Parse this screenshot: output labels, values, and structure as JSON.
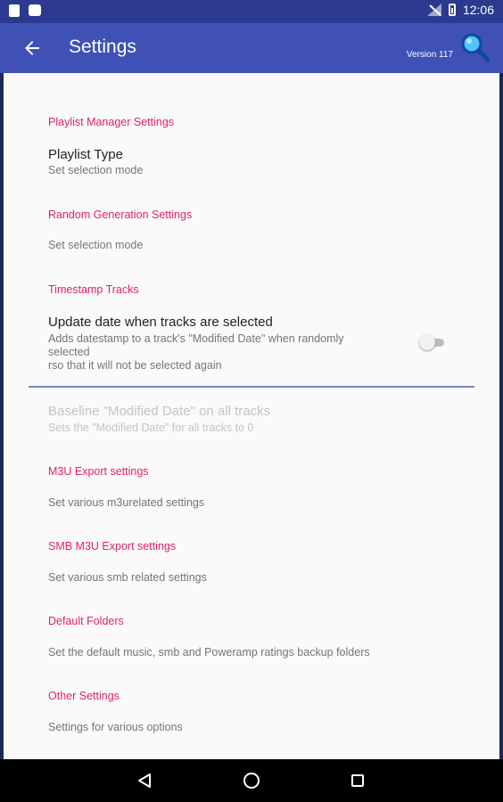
{
  "status_bar": {
    "time": "12:06",
    "icons": [
      "notification-icon",
      "notification-icon-2",
      "signal-off-icon",
      "battery-icon"
    ]
  },
  "app_bar": {
    "title": "Settings",
    "version": "Version 117",
    "back_icon": "arrow-back-icon",
    "search_icon": "search-icon",
    "color": "#3f51b5"
  },
  "settings": {
    "playlist_manager": {
      "header": "Playlist Manager Settings",
      "playlist_type": {
        "title": "Playlist Type",
        "summary": "Set selection mode"
      }
    },
    "random_generation": {
      "header": "Random Generation Settings",
      "summary": "Set selection mode"
    },
    "timestamp": {
      "header": "Timestamp Tracks",
      "update_date": {
        "title": "Update date when tracks are selected",
        "summary_line1": "Adds datestamp to a track's \"Modified Date\" when randomly",
        "summary_line2": "selected",
        "summary_line3": "rso that it will not be selected again",
        "enabled": false
      },
      "baseline": {
        "title": "Baseline \"Modified Date\" on all tracks",
        "summary": "Sets the \"Modified Date\" for all tracks to 0"
      }
    },
    "m3u_export": {
      "header": "M3U Export settings",
      "summary": "Set various m3urelated settings"
    },
    "smb_m3u_export": {
      "header": "SMB M3U Export settings",
      "summary": "Set various smb related settings"
    },
    "default_folders": {
      "header": "Default Folders",
      "summary": "Set the default music, smb and Poweramp ratings backup folders"
    },
    "other": {
      "header": "Other Settings",
      "summary": "Settings for various options"
    }
  },
  "colors": {
    "accent": "#e91e63",
    "divider": "#7986cb"
  },
  "nav_bar": {
    "back": "triangle-back-icon",
    "home": "circle-home-icon",
    "recents": "square-recents-icon"
  }
}
